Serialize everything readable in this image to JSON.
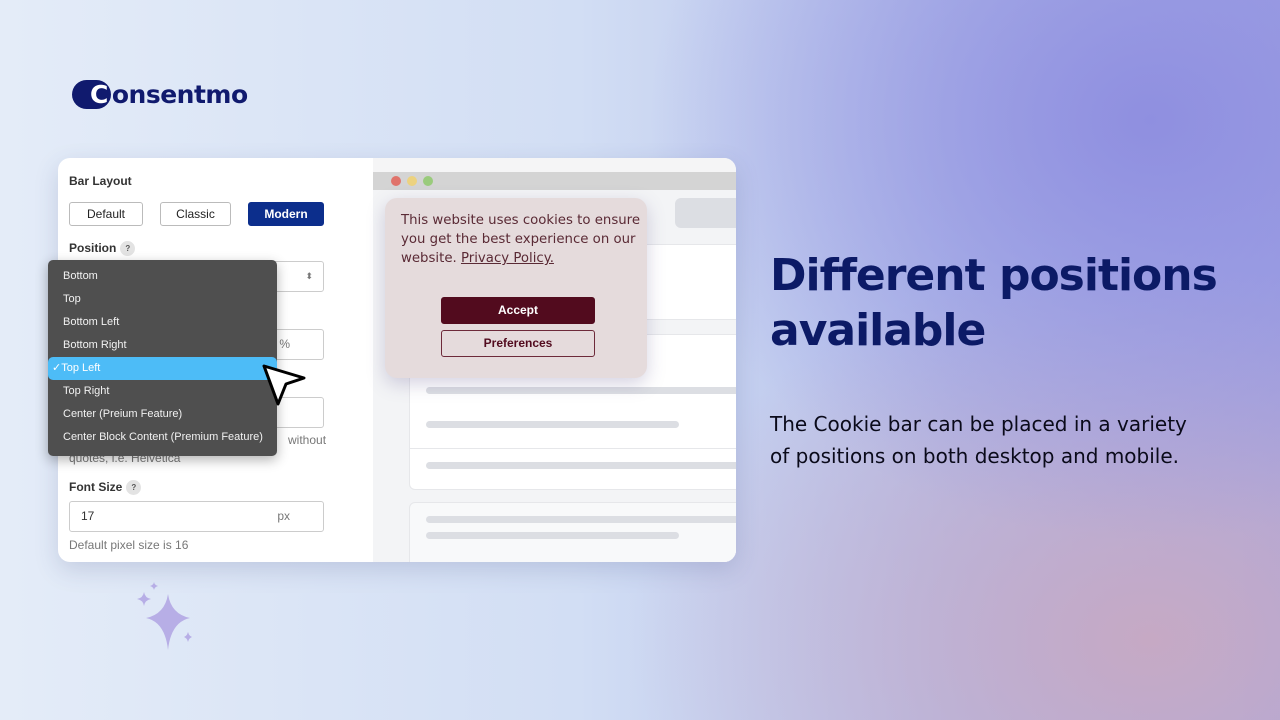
{
  "brand": {
    "name": "Consentmo",
    "color": "#101a6e"
  },
  "settings": {
    "bar_layout_label": "Bar Layout",
    "layout_buttons": [
      {
        "label": "Default",
        "active": false
      },
      {
        "label": "Classic",
        "active": false
      },
      {
        "label": "Modern",
        "active": true
      }
    ],
    "position_label": "Position",
    "help_icon": "?",
    "position_options": [
      "Bottom",
      "Top",
      "Bottom Left",
      "Bottom Right",
      "Top Left",
      "Top Right",
      "Center (Preium Feature)",
      "Center Block Content (Premium Feature)"
    ],
    "selected_position": "Top Left",
    "width_suffix": "%",
    "font_help_partial": "without",
    "font_help_line2": "quotes, i.e. Helvetica",
    "font_size_label": "Font Size",
    "font_size_value": "17",
    "font_size_suffix": "px",
    "font_size_help": "Default pixel size is 16"
  },
  "preview": {
    "cookie_text": "This website uses cookies to ensure you get the best experience on our website.",
    "privacy_link": "Privacy Policy.",
    "accept_label": "Accept",
    "preferences_label": "Preferences",
    "accent": "#520b1e"
  },
  "marketing": {
    "headline_line1": "Different positions",
    "headline_line2": "available",
    "description": "The Cookie bar can be placed in a variety of positions on both desktop and mobile."
  }
}
